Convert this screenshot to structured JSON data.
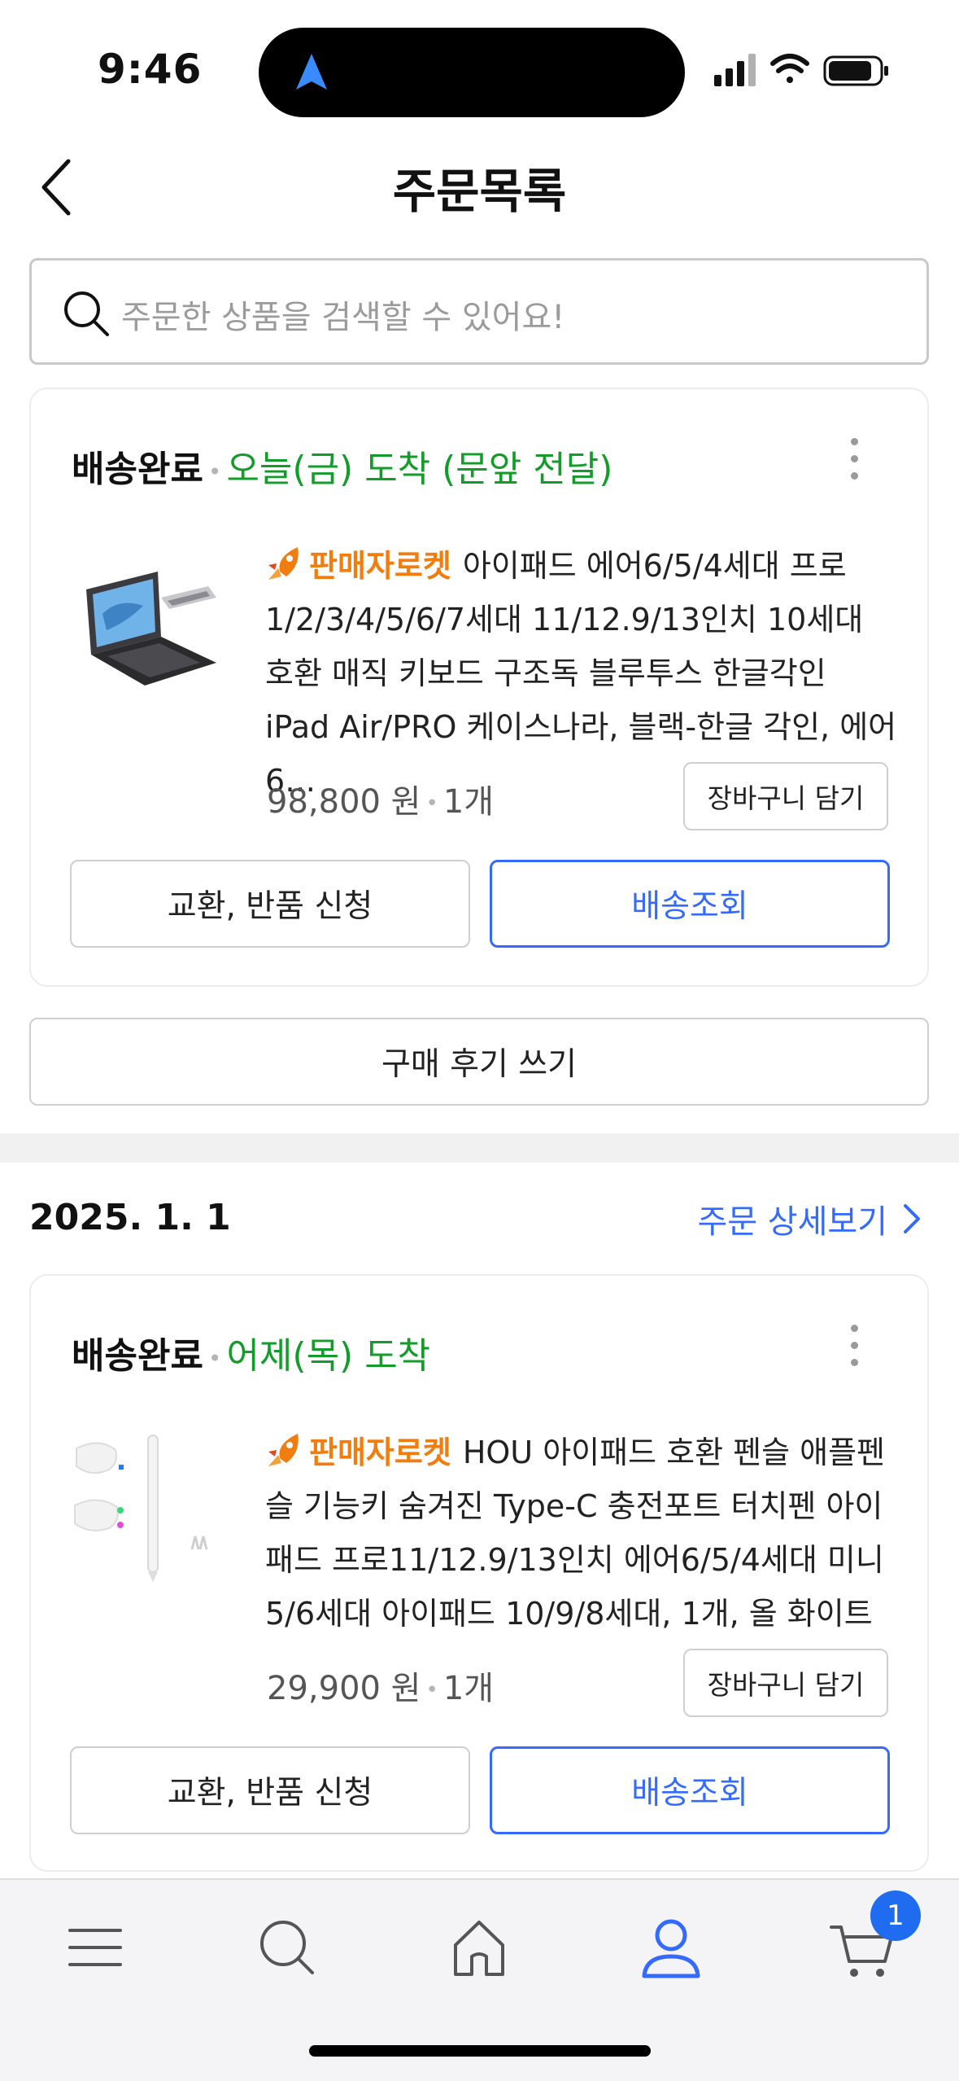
{
  "status_bar": {
    "time": "9:46",
    "icons": [
      "location-arrow-icon",
      "signal-icon",
      "wifi-icon",
      "battery-icon"
    ]
  },
  "header": {
    "title": "주문목록",
    "back_icon": "chevron-left-icon"
  },
  "search": {
    "placeholder": "주문한 상품을 검색할 수 있어요!",
    "icon": "search-icon"
  },
  "orders": [
    {
      "status": "배송완료",
      "status_detail": "오늘(금) 도착 (문앞 전달)",
      "badge": "판매자로켓",
      "title": "아이패드 에어6/5/4세대 프로 1/2/3/4/5/6/7세대 11/12.9/13인치 10세대 호환 매직 키보드 구조독 블루투스 한글각인 iPad Air/PRO 케이스나라, 블랙-한글 각인, 에어6…",
      "price": "98,800 원",
      "quantity": "1개",
      "cart_label": "장바구니 담기",
      "exchange_label": "교환, 반품 신청",
      "track_label": "배송조회",
      "review_label": "구매 후기 쓰기"
    },
    {
      "date": "2025. 1. 1",
      "detail_link": "주문 상세보기",
      "status": "배송완료",
      "status_detail": "어제(목) 도착",
      "badge": "판매자로켓",
      "title": "HOU 아이패드 호환 펜슬 애플펜슬 기능키 숨겨진 Type-C 충전포트 터치펜 아이패드 프로11/12.9/13인치 에어6/5/4세대 미니5/6세대 아이패드 10/9/8세대, 1개, 올 화이트",
      "price": "29,900 원",
      "quantity": "1개",
      "cart_label": "장바구니 담기",
      "exchange_label": "교환, 반품 신청",
      "track_label": "배송조회"
    }
  ],
  "tab_bar": {
    "tabs": [
      "menu-icon",
      "search-icon",
      "home-icon",
      "my-page-icon",
      "cart-icon"
    ],
    "active": "my-page-icon",
    "cart_badge": "1"
  },
  "colors": {
    "accent": "#346aff",
    "delivered_green": "#139c2a",
    "rocket_orange": "#f07d0e",
    "badge_blue": "#1f6cf0"
  }
}
